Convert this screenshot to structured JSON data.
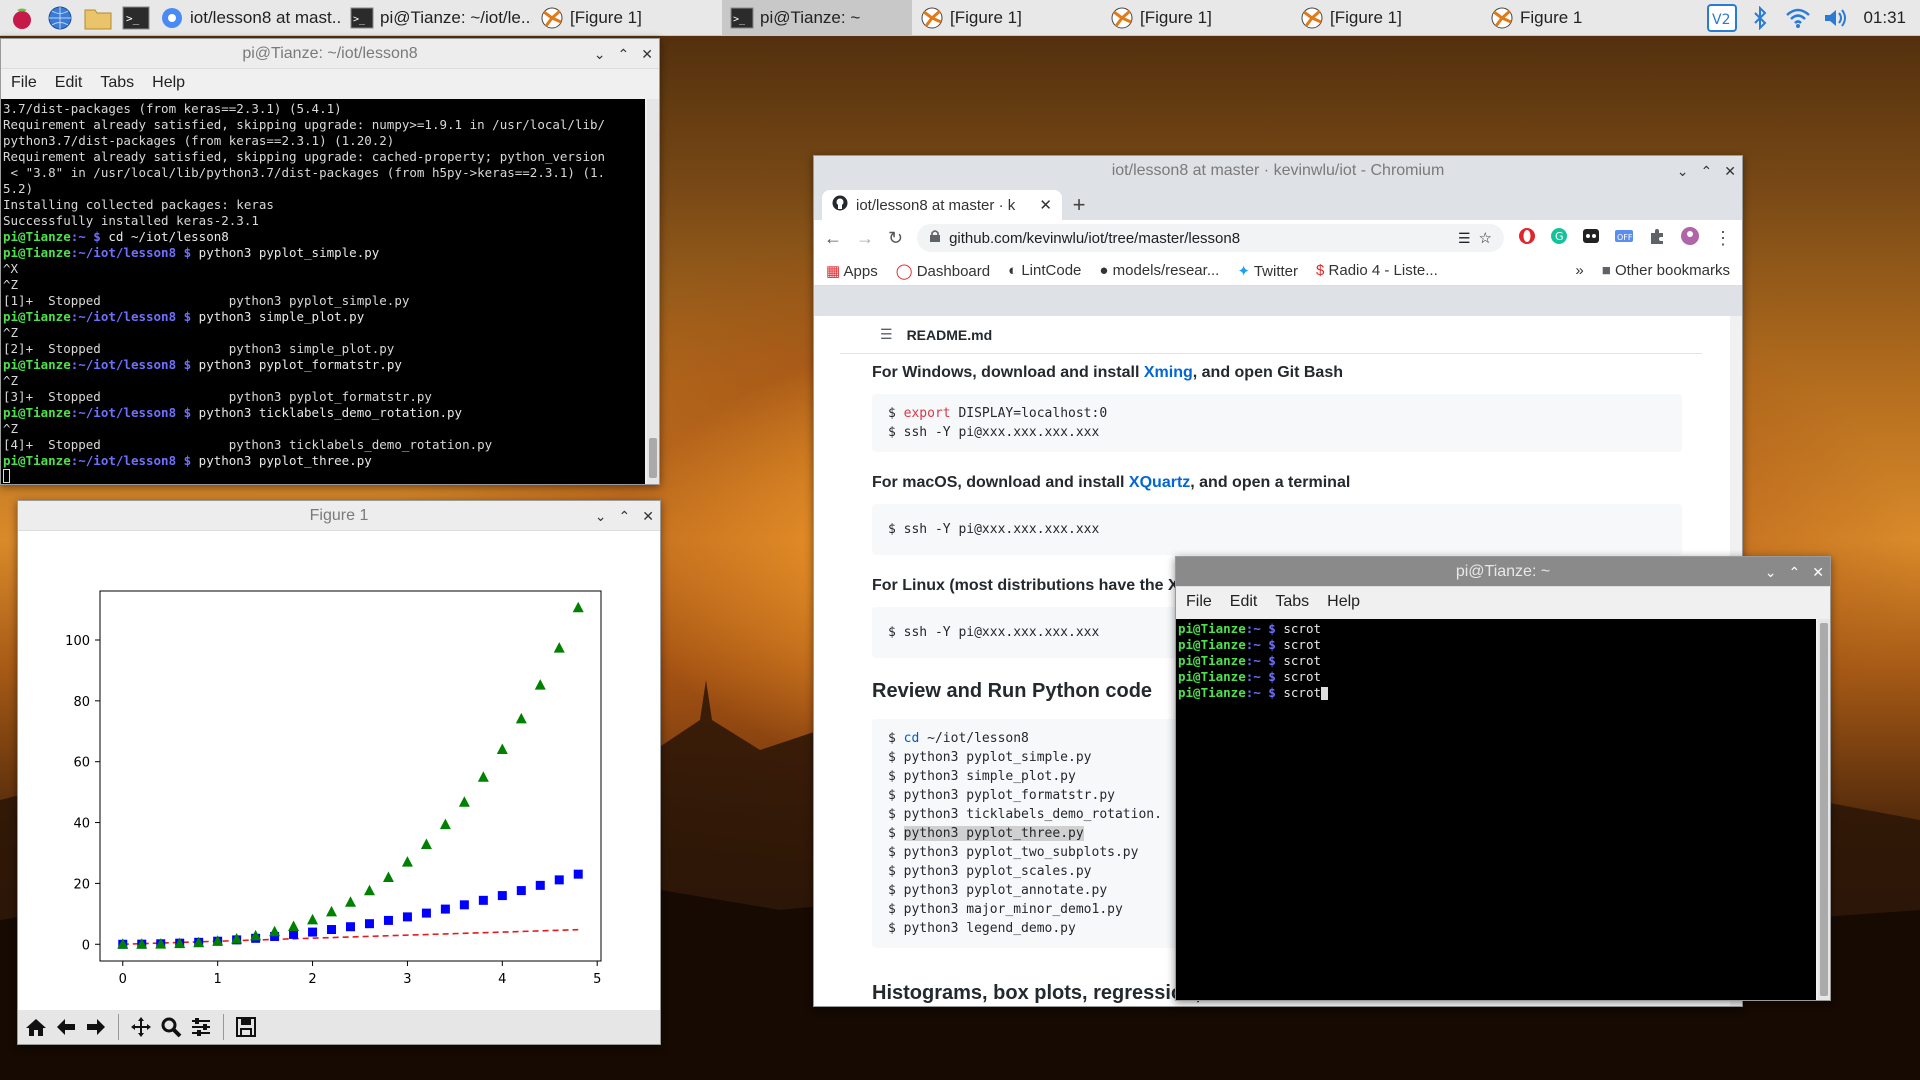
{
  "taskbar": {
    "tasks": [
      {
        "label": "iot/lesson8 at mast..."
      },
      {
        "label": "pi@Tianze: ~/iot/le..."
      },
      {
        "label": "[Figure 1]"
      },
      {
        "label": "pi@Tianze: ~"
      },
      {
        "label": "[Figure 1]"
      },
      {
        "label": "[Figure 1]"
      },
      {
        "label": "[Figure 1]"
      },
      {
        "label": "Figure 1"
      }
    ],
    "clock": "01:31"
  },
  "term1": {
    "title": "pi@Tianze: ~/iot/lesson8",
    "menu": [
      "File",
      "Edit",
      "Tabs",
      "Help"
    ],
    "lines": [
      "3.7/dist-packages (from keras==2.3.1) (5.4.1)",
      "Requirement already satisfied, skipping upgrade: numpy>=1.9.1 in /usr/local/lib/",
      "python3.7/dist-packages (from keras==2.3.1) (1.20.2)",
      "Requirement already satisfied, skipping upgrade: cached-property; python_version",
      " < \"3.8\" in /usr/local/lib/python3.7/dist-packages (from h5py->keras==2.3.1) (1.",
      "5.2)",
      "Installing collected packages: keras",
      "Successfully installed keras-2.3.1"
    ],
    "prompt_user": "pi@Tianze",
    "cmds": [
      {
        "path": ":~ $ ",
        "cmd": "cd ~/iot/lesson8",
        "after": []
      },
      {
        "path": ":~/iot/lesson8 $ ",
        "cmd": "python3 pyplot_simple.py",
        "after": [
          "^X",
          "^Z",
          "[1]+  Stopped                 python3 pyplot_simple.py"
        ]
      },
      {
        "path": ":~/iot/lesson8 $ ",
        "cmd": "python3 simple_plot.py",
        "after": [
          "^Z",
          "[2]+  Stopped                 python3 simple_plot.py"
        ]
      },
      {
        "path": ":~/iot/lesson8 $ ",
        "cmd": "python3 pyplot_formatstr.py",
        "after": [
          "^Z",
          "[3]+  Stopped                 python3 pyplot_formatstr.py"
        ]
      },
      {
        "path": ":~/iot/lesson8 $ ",
        "cmd": "python3 ticklabels_demo_rotation.py",
        "after": [
          "^Z",
          "[4]+  Stopped                 python3 ticklabels_demo_rotation.py"
        ]
      },
      {
        "path": ":~/iot/lesson8 $ ",
        "cmd": "python3 pyplot_three.py",
        "after": []
      }
    ]
  },
  "figure": {
    "title": "Figure 1"
  },
  "chart_data": {
    "type": "scatter",
    "x": [
      0.0,
      0.2,
      0.4,
      0.6,
      0.8,
      1.0,
      1.2,
      1.4,
      1.6,
      1.8,
      2.0,
      2.2,
      2.4,
      2.6,
      2.8,
      3.0,
      3.2,
      3.4,
      3.6,
      3.8,
      4.0,
      4.2,
      4.4,
      4.6,
      4.8
    ],
    "series": [
      {
        "style": "red dashed line",
        "color": "#e41a1c",
        "values": [
          0.0,
          0.2,
          0.4,
          0.6,
          0.8,
          1.0,
          1.2,
          1.4,
          1.6,
          1.8,
          2.0,
          2.2,
          2.4,
          2.6,
          2.8,
          3.0,
          3.2,
          3.4,
          3.6,
          3.8,
          4.0,
          4.2,
          4.4,
          4.6,
          4.8
        ]
      },
      {
        "style": "blue squares",
        "color": "#0000ff",
        "values": [
          0.0,
          0.04,
          0.16,
          0.36,
          0.64,
          1.0,
          1.44,
          1.96,
          2.56,
          3.24,
          4.0,
          4.84,
          5.76,
          6.76,
          7.84,
          9.0,
          10.24,
          11.56,
          12.96,
          14.44,
          16.0,
          17.64,
          19.36,
          21.16,
          23.04
        ]
      },
      {
        "style": "green triangles",
        "color": "#008000",
        "values": [
          0.0,
          0.008,
          0.064,
          0.216,
          0.512,
          1.0,
          1.728,
          2.744,
          4.096,
          5.832,
          8.0,
          10.648,
          13.824,
          17.576,
          21.952,
          27.0,
          32.768,
          39.304,
          46.656,
          54.872,
          64.0,
          74.088,
          85.184,
          97.336,
          110.592
        ]
      }
    ],
    "xticks": [
      "0",
      "1",
      "2",
      "3",
      "4",
      "5"
    ],
    "yticks": [
      "0",
      "20",
      "40",
      "60",
      "80",
      "100"
    ],
    "xlim": [
      -0.24,
      5.04
    ],
    "ylim": [
      -5.5,
      116.1
    ],
    "grid": false
  },
  "browser": {
    "title": "iot/lesson8 at master · kevinwlu/iot - Chromium",
    "tab_label": "iot/lesson8 at master · k",
    "url": "github.com/kevinwlu/iot/tree/master/lesson8",
    "bookmarks": [
      "Apps",
      "Dashboard",
      "LintCode",
      "models/resear...",
      "Twitter",
      "Radio 4 - Liste...",
      "»",
      "Other bookmarks"
    ],
    "readme": "README.md",
    "h_windows_pre": "For Windows, download and install ",
    "h_windows_link": "Xming",
    "h_windows_post": ", and open Git Bash",
    "code_windows_1_a": "$ ",
    "code_windows_1_kw": "export",
    "code_windows_1_b": " DISPLAY=localhost:0",
    "code_windows_2": "$ ssh -Y pi@xxx.xxx.xxx.xxx",
    "h_mac_pre": "For macOS, download and install ",
    "h_mac_link": "XQuartz",
    "h_mac_post": ", and open a terminal",
    "code_mac": "$ ssh -Y pi@xxx.xxx.xxx.xxx",
    "h_linux": "For Linux (most distributions have the X",
    "code_linux": "$ ssh -Y pi@xxx.xxx.xxx.xxx",
    "h_review": "Review and Run Python code",
    "code_cd_a": "$ ",
    "code_cd_kw": "cd",
    "code_cd_b": " ~/iot/lesson8",
    "code_runs": [
      "$ python3 pyplot_simple.py",
      "$ python3 simple_plot.py",
      "$ python3 pyplot_formatstr.py",
      "$ python3 ticklabels_demo_rotation."
    ],
    "code_hl_prefix": "$ ",
    "code_hl": "python3 pyplot_three.py",
    "code_runs2": [
      "$ python3 pyplot_two_subplots.py",
      "$ python3 pyplot_scales.py",
      "$ python3 pyplot_annotate.py",
      "$ python3 major_minor_demo1.py",
      "$ python3 legend_demo.py"
    ],
    "h_hist": "Histograms, box plots, regression, and classification"
  },
  "term2": {
    "title": "pi@Tianze: ~",
    "menu": [
      "File",
      "Edit",
      "Tabs",
      "Help"
    ],
    "prompt_user": "pi@Tianze",
    "prompt_path": ":~ $ ",
    "cmd": "scrot"
  }
}
